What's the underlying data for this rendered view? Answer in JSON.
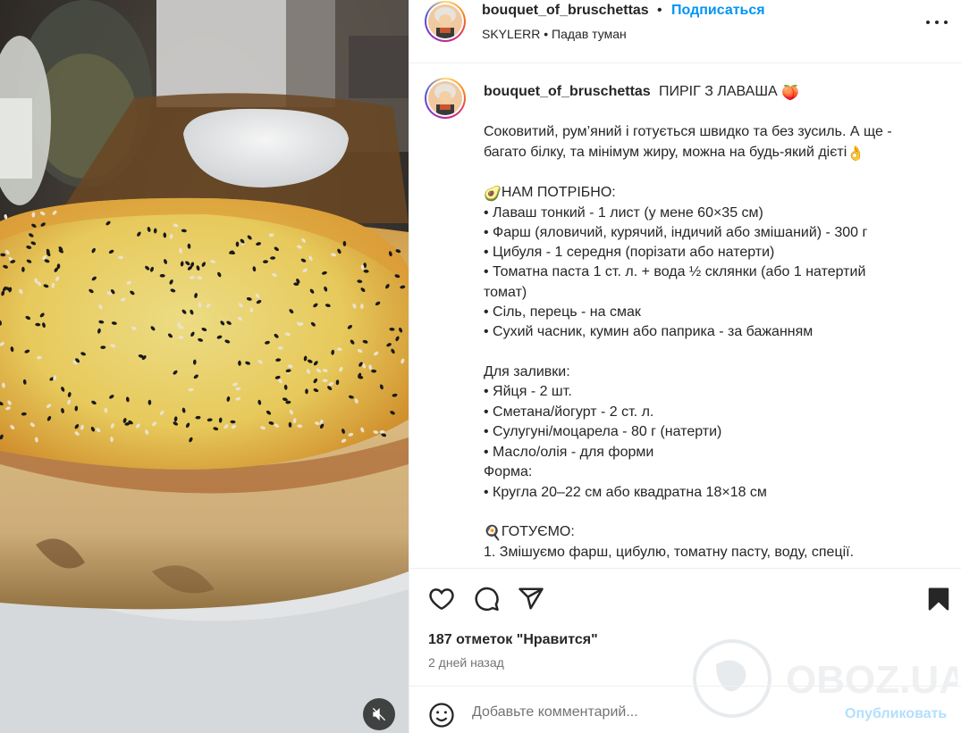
{
  "header": {
    "username": "bouquet_of_bruschettas",
    "separator": "•",
    "follow_label": "Подписаться",
    "audio": "SKYLERR • Падав туман"
  },
  "caption": {
    "username": "bouquet_of_bruschettas",
    "title": "ПИРІГ З ЛАВАША",
    "title_emoji": "🍑",
    "lines": [
      "Соковитий, рум’яний і готується швидко та без зусиль. А ще -",
      "багато білку, та мінімум жиру, можна на будь-який дієті",
      "",
      "НАМ ПОТРІБНО:",
      "• Лаваш тонкий - 1 лист (у мене 60×35 см)",
      "• Фарш (яловичий, курячий, індичий або змішаний) - 300 г",
      "• Цибуля - 1 середня (порізати або натерти)",
      "• Томатна паста 1 ст. л. + вода ½ склянки (або 1 натертий",
      "томат)",
      "• Сіль, перець - на смак",
      "• Сухий часник, кумин або паприка - за бажанням",
      "",
      "Для заливки:",
      "• Яйця - 2 шт.",
      "• Сметана/йогурт - 2 ст. л.",
      "• Сулугуні/моцарела - 80 г (натерти)",
      "• Масло/олія - для форми",
      "Форма:",
      "• Кругла 20–22 см або квадратна 18×18 см",
      "",
      "ГОТУЄМО:",
      "1. Змішуємо фарш, цибулю, томатну пасту, воду, спеції."
    ],
    "line_emojis": {
      "1": "👌",
      "3": "🥑",
      "20": "🍳"
    }
  },
  "actions": {
    "likes": "187 отметок \"Нравится\"",
    "time": "2 дней назад"
  },
  "comment": {
    "placeholder": "Добавьте комментарий...",
    "publish_label": "Опубликовать"
  },
  "watermark": {
    "text": "OBOZ.UA"
  },
  "icons": [
    "more-icon",
    "heart-icon",
    "comment-icon",
    "share-icon",
    "bookmark-icon",
    "emoji-icon",
    "mute-icon"
  ],
  "colors": {
    "link": "#0095f6",
    "publish_disabled": "#b2dffc",
    "text": "#262626",
    "muted": "#737373",
    "border": "#efefef"
  }
}
